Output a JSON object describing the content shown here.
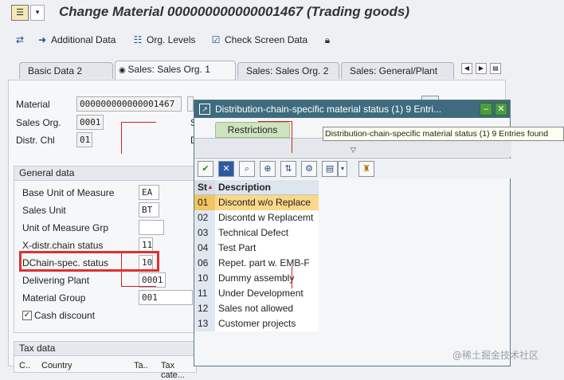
{
  "window": {
    "title": "Change Material 000000000000001467 (Trading goods)"
  },
  "toolbar": {
    "items": [
      {
        "label": "Additional Data",
        "icon": "arrow-right-icon"
      },
      {
        "label": "Org. Levels",
        "icon": "org-levels-icon"
      },
      {
        "label": "Check Screen Data",
        "icon": "check-screen-icon"
      }
    ]
  },
  "tabs": [
    {
      "label": "Basic Data 2"
    },
    {
      "label": "Sales: Sales Org. 1"
    },
    {
      "label": "Sales: Sales Org. 2"
    },
    {
      "label": "Sales: General/Plant"
    }
  ],
  "header_fields": {
    "material_label": "Material",
    "material_value": "000000000000001467",
    "sales_org_label": "Sales Org.",
    "sales_org_value": "0001",
    "distr_chl_label": "Distr. Chl",
    "distr_chl_value": "01"
  },
  "general_data": {
    "title": "General data",
    "rows": [
      {
        "label": "Base Unit of Measure",
        "value": "EA"
      },
      {
        "label": "Sales Unit",
        "value": "BT"
      },
      {
        "label": "Unit of Measure Grp",
        "value": ""
      },
      {
        "label": "X-distr.chain status",
        "value": "11"
      },
      {
        "label": "DChain-spec. status",
        "value": "10"
      },
      {
        "label": "Delivering Plant",
        "value": "0001"
      },
      {
        "label": "Material Group",
        "value": "001"
      }
    ],
    "cash_discount_label": "Cash discount",
    "cash_discount_checked": true
  },
  "tax_data": {
    "title": "Tax data",
    "cols": [
      "C..",
      "Country",
      "Ta..",
      "Tax cate..."
    ]
  },
  "popup": {
    "title": "Distribution-chain-specific material status (1)   9 Entri...",
    "restrictions_tab": "Restrictions",
    "list_header_code": "St",
    "list_header_desc": "Description",
    "entries": [
      {
        "code": "01",
        "desc": "Discontd w/o Replace",
        "selected": true
      },
      {
        "code": "02",
        "desc": "Discontd w Replacemt",
        "selected": false
      },
      {
        "code": "03",
        "desc": "Technical Defect",
        "selected": false
      },
      {
        "code": "04",
        "desc": "Test Part",
        "selected": false
      },
      {
        "code": "06",
        "desc": "Repet. part w. EMB-F",
        "selected": false
      },
      {
        "code": "10",
        "desc": "Dummy assembly",
        "selected": false
      },
      {
        "code": "11",
        "desc": "Under Development",
        "selected": false
      },
      {
        "code": "12",
        "desc": "Sales not allowed",
        "selected": false
      },
      {
        "code": "13",
        "desc": "Customer projects",
        "selected": false
      }
    ]
  },
  "tooltip": "Distribution-chain-specific material status (1)    9 Entries found",
  "watermark": "@稀土掘金技术社区"
}
